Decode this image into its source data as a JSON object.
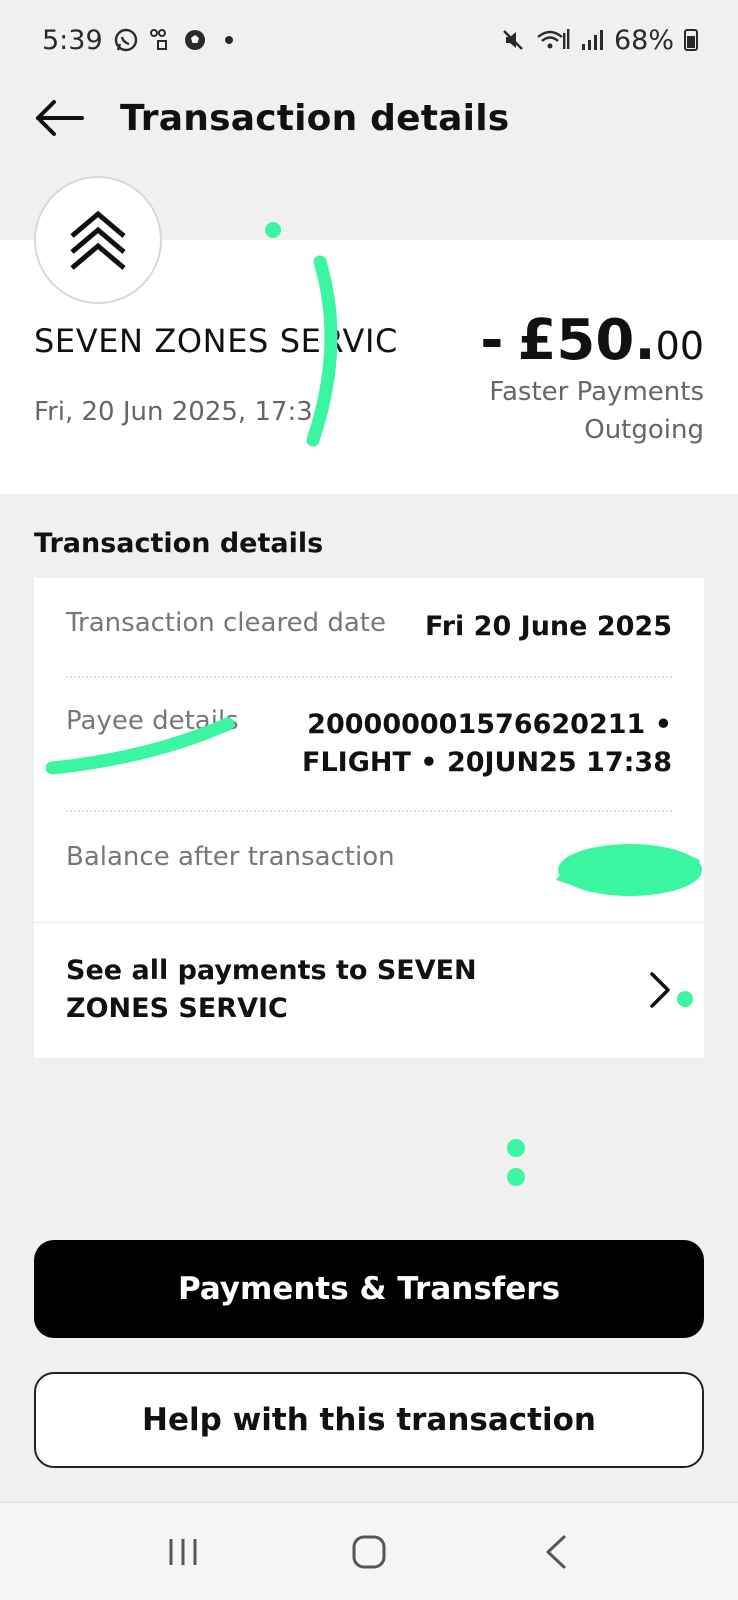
{
  "status_bar": {
    "time": "5:39",
    "battery": "68%"
  },
  "header": {
    "title": "Transaction details"
  },
  "summary": {
    "merchant": "SEVEN ZONES SERVIC",
    "date": "Fri, 20 Jun 2025, 17:3",
    "amount_sign": "-",
    "amount_whole": "£50.",
    "amount_decimal": "00",
    "payment_type_line1": "Faster Payments",
    "payment_type_line2": "Outgoing"
  },
  "details": {
    "section_title": "Transaction details",
    "cleared_label": "Transaction cleared date",
    "cleared_value": "Fri 20 June 2025",
    "payee_label": "Payee details",
    "payee_value_line1": "200000001576620211 •",
    "payee_value_line2": "FLIGHT • 20JUN25 17:38",
    "balance_label": "Balance after transaction",
    "see_all_label": "See all payments to SEVEN ZONES SERVIC"
  },
  "buttons": {
    "primary": "Payments & Transfers",
    "secondary": "Help with this transaction"
  },
  "colors": {
    "accent_scribble": "#3cf5a0",
    "primary_button": "#000000"
  }
}
